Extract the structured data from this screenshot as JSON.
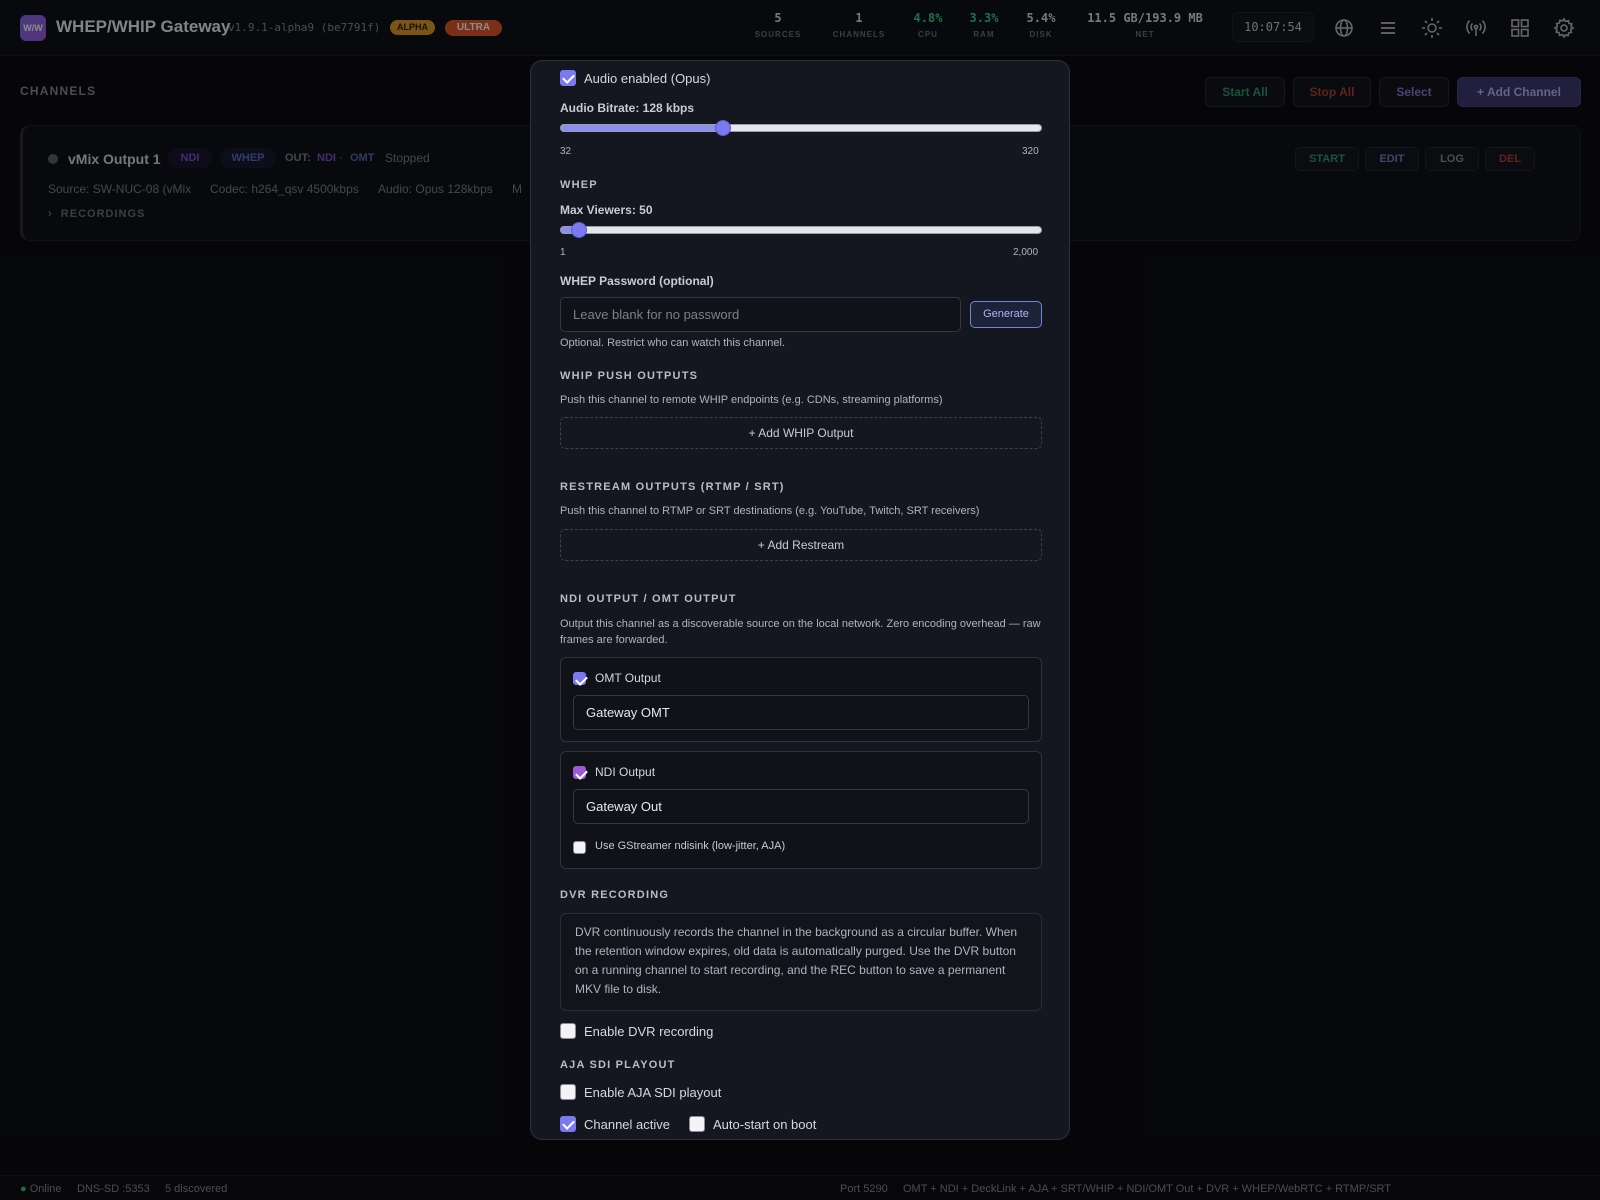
{
  "app": {
    "logo_text": "W/W",
    "title": "WHEP/WHIP Gateway",
    "version": "v1.9.1-alpha9 (be7791f)",
    "badge_alpha": "ALPHA",
    "badge_ultra": "ULTRA"
  },
  "stats": [
    {
      "value": "5",
      "label": "SOURCES"
    },
    {
      "value": "1",
      "label": "CHANNELS"
    },
    {
      "value": "4.8%",
      "label": "CPU"
    },
    {
      "value": "3.3%",
      "label": "RAM"
    },
    {
      "value": "5.4%",
      "label": "DISK"
    },
    {
      "value": "11.5 GB/193.9 MB",
      "label": "NET"
    }
  ],
  "clock": "10:07:54",
  "topbar_icons": [
    "globe-icon",
    "menu-icon",
    "sun-icon",
    "broadcast-icon",
    "grid-icon",
    "gear-icon"
  ],
  "page": {
    "section_title": "CHANNELS",
    "start_all": "Start All",
    "stop_all": "Stop All",
    "select": "Select",
    "add_channel": "+ Add Channel"
  },
  "channel": {
    "name": "vMix Output 1",
    "tags": [
      "NDI",
      "WHEP"
    ],
    "out_label": "OUT:",
    "out_ndi": "NDI",
    "out_sep": "·",
    "out_omt": "OMT",
    "status": "Stopped",
    "source": "Source: SW-NUC-08 (vMix",
    "codec": "Codec: h264_qsv 4500kbps",
    "audio": "Audio: Opus 128kbps",
    "trunc": "M",
    "recordings": "RECORDINGS",
    "recordings_arrow": "›",
    "actions": [
      "START",
      "EDIT",
      "LOG",
      "DEL"
    ]
  },
  "modal": {
    "audio_enabled_label": "Audio enabled (Opus)",
    "audio_enabled": true,
    "audio_bitrate_label": "Audio Bitrate: 128 kbps",
    "audio_bitrate": {
      "value": 128,
      "min": 32,
      "max": 320,
      "min_label": "32",
      "max_label": "320"
    },
    "whep_heading": "WHEP",
    "max_viewers_label": "Max Viewers: 50",
    "max_viewers": {
      "value": 50,
      "min": 1,
      "max": 2000,
      "min_label": "1",
      "max_label": "2,000"
    },
    "whep_password_label": "WHEP Password (optional)",
    "whep_password_placeholder": "Leave blank for no password",
    "generate_label": "Generate",
    "whep_password_hint": "Optional. Restrict who can watch this channel.",
    "whip_heading": "WHIP PUSH OUTPUTS",
    "whip_hint": "Push this channel to remote WHIP endpoints (e.g. CDNs, streaming platforms)",
    "add_whip": "+ Add WHIP Output",
    "restream_heading": "RESTREAM OUTPUTS (RTMP / SRT)",
    "restream_hint": "Push this channel to RTMP or SRT destinations (e.g. YouTube, Twitch, SRT receivers)",
    "add_restream": "+ Add Restream",
    "ndi_heading": "NDI OUTPUT / OMT OUTPUT",
    "ndi_hint": "Output this channel as a discoverable source on the local network. Zero encoding overhead — raw frames are forwarded.",
    "omt_output_label": "OMT Output",
    "omt_output_enabled": true,
    "omt_name": "Gateway OMT",
    "ndi_output_label": "NDI Output",
    "ndi_output_enabled": true,
    "ndi_name": "Gateway Out",
    "gst_label": "Use GStreamer ndisink (low-jitter, AJA)",
    "gst_enabled": false,
    "dvr_heading": "DVR RECORDING",
    "dvr_info": "DVR continuously records the channel in the background as a circular buffer. When the retention window expires, old data is automatically purged. Use the DVR button on a running channel to start recording, and the REC button to save a permanent MKV file to disk.",
    "dvr_enable_label": "Enable DVR recording",
    "dvr_enabled": false,
    "aja_heading": "AJA SDI PLAYOUT",
    "aja_enable_label": "Enable AJA SDI playout",
    "aja_enabled": false,
    "channel_active_label": "Channel active",
    "channel_active": true,
    "autostart_label": "Auto-start on boot",
    "autostart": false
  },
  "statusbar": {
    "online": "● Online",
    "dnssd": "DNS-SD :5353",
    "discovered": "5 discovered",
    "port": "Port 5290",
    "features": "OMT + NDI + DeckLink + AJA + SRT/WHIP + NDI/OMT Out + DVR + WHEP/WebRTC + RTMP/SRT"
  },
  "colors": {
    "accent": "#7a79ef",
    "success": "#36c98b",
    "danger": "#b0403a",
    "warning": "#e09b2a"
  }
}
